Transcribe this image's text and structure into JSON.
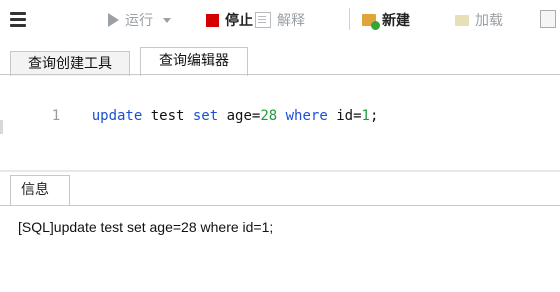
{
  "toolbar": {
    "run_label": "运行",
    "stop_label": "停止",
    "explain_label": "解释",
    "new_label": "新建",
    "load_label": "加载"
  },
  "tabs": [
    {
      "label": "查询创建工具"
    },
    {
      "label": "查询编辑器"
    }
  ],
  "editor": {
    "line_number": "1",
    "kw_update": "update",
    "t_test": " test ",
    "kw_set": "set",
    "t_age": " age=",
    "n_28": "28",
    "sp1": " ",
    "kw_where": "where",
    "t_id": " id=",
    "n_1": "1",
    "t_semi": ";"
  },
  "info": {
    "tab_label": "信息",
    "message": "[SQL]update test set age=28 where id=1;"
  },
  "colors": {
    "keyword": "#1a4fd6",
    "number": "#1e9a3a",
    "stop_red": "#d40000"
  }
}
